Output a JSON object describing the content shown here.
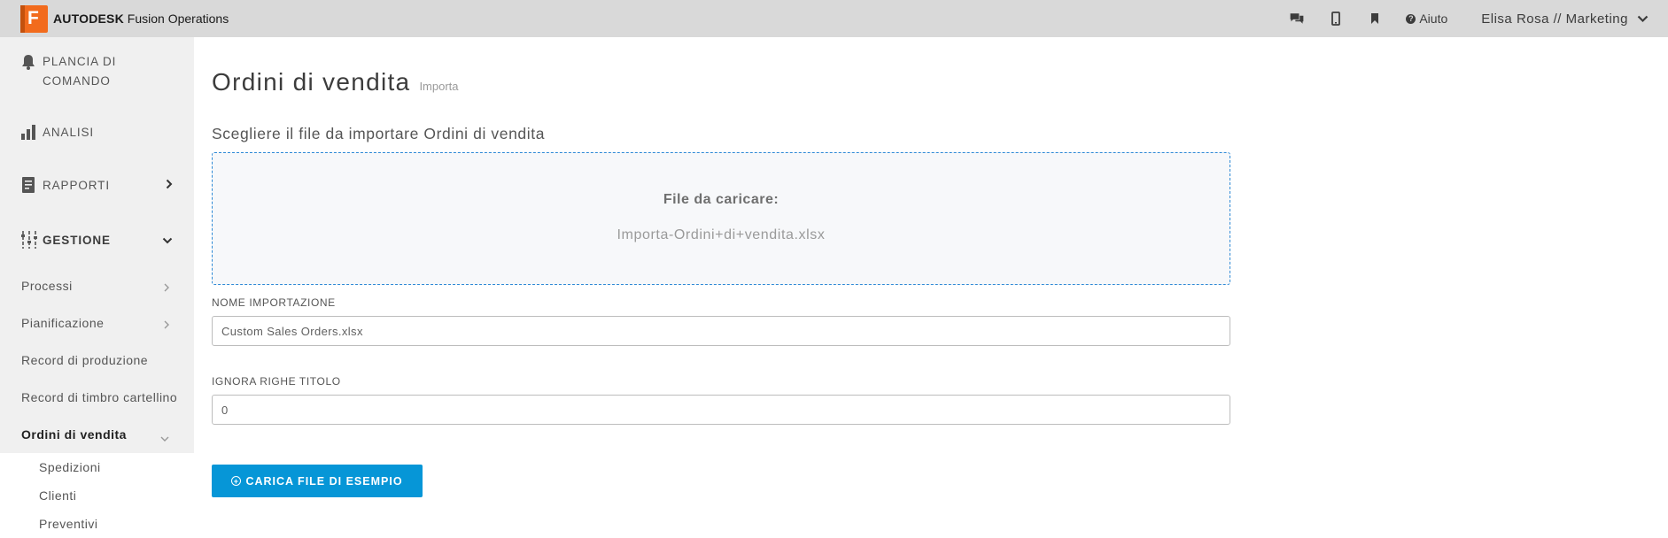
{
  "topbar": {
    "brand_bold": "AUTODESK",
    "brand_rest": "Fusion Operations",
    "help_label": "Aiuto",
    "user_label": "Elisa Rosa // Marketing"
  },
  "sidebar": {
    "plancia": "PLANCIA DI COMANDO",
    "analisi": "ANALISI",
    "rapporti": "RAPPORTI",
    "gestione": "GESTIONE",
    "sub_items": {
      "processi": "Processi",
      "pianificazione": "Pianificazione",
      "record_produzione": "Record di produzione",
      "record_timbro": "Record di timbro cartellino",
      "ordini": "Ordini di vendita"
    },
    "subsub_items": {
      "spedizioni": "Spedizioni",
      "clienti": "Clienti",
      "preventivi": "Preventivi"
    }
  },
  "main": {
    "title": "Ordini di vendita",
    "breadcrumb": "Importa",
    "section_label": "Scegliere il file da importare Ordini di vendita",
    "dropzone": {
      "title": "File da caricare:",
      "file_name": "Importa-Ordini+di+vendita.xlsx"
    },
    "import_name": {
      "label": "NOME IMPORTAZIONE",
      "value": "Custom Sales Orders.xlsx"
    },
    "ignore_rows": {
      "label": "IGNORA RIGHE TITOLO",
      "value": "0"
    },
    "upload_button": "CARICA FILE DI ESEMPIO"
  },
  "colors": {
    "accent": "#0696d7",
    "logo": "#f26b1d",
    "topbar": "#d9d9d9"
  }
}
